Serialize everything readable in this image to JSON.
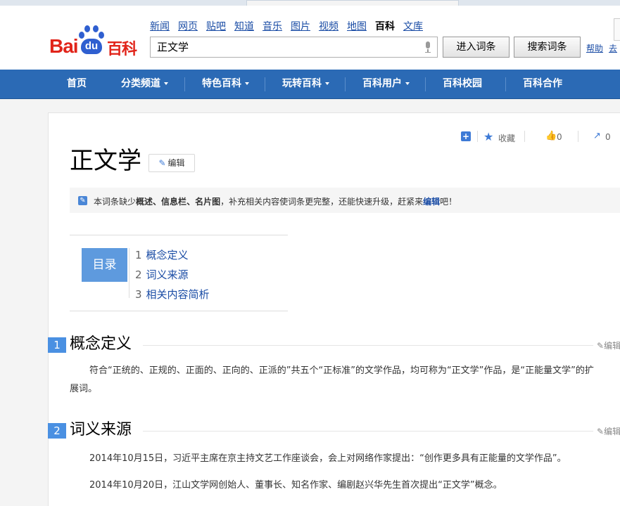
{
  "header": {
    "logo": {
      "bai": "Bai",
      "du": "du",
      "baike": "百科"
    },
    "nav_links": [
      {
        "label": "新闻",
        "active": false
      },
      {
        "label": "网页",
        "active": false
      },
      {
        "label": "贴吧",
        "active": false
      },
      {
        "label": "知道",
        "active": false
      },
      {
        "label": "音乐",
        "active": false
      },
      {
        "label": "图片",
        "active": false
      },
      {
        "label": "视频",
        "active": false
      },
      {
        "label": "地图",
        "active": false
      },
      {
        "label": "百科",
        "active": true
      },
      {
        "label": "文库",
        "active": false
      }
    ],
    "search": {
      "value": "正文学"
    },
    "enter_button": "进入词条",
    "search_button": "搜索词条",
    "help_link": "帮助",
    "help_link2": "去"
  },
  "main_nav": [
    {
      "label": "首页",
      "dropdown": false
    },
    {
      "label": "分类频道",
      "dropdown": true
    },
    {
      "label": "特色百科",
      "dropdown": true
    },
    {
      "label": "玩转百科",
      "dropdown": true
    },
    {
      "label": "百科用户",
      "dropdown": true
    },
    {
      "label": "百科校园",
      "dropdown": false
    },
    {
      "label": "百科合作",
      "dropdown": false
    }
  ],
  "toolbar": {
    "favorite_label": "收藏",
    "like_count": "0",
    "share_count": "0"
  },
  "article": {
    "title": "正文学",
    "edit_label": "编辑",
    "notice": {
      "prefix": "本词条缺少",
      "item1": "概述",
      "sep1": "、",
      "item2": "信息栏",
      "sep2": "、",
      "item3": "名片图",
      "middle": "，补充相关内容使词条更完整，还能快速升级，赶紧来",
      "link": "编辑",
      "suffix": "吧！"
    },
    "toc": {
      "label": "目录",
      "items": [
        {
          "num": "1",
          "text": "概念定义"
        },
        {
          "num": "2",
          "text": "词义来源"
        },
        {
          "num": "3",
          "text": "相关内容简析"
        }
      ]
    },
    "sections": [
      {
        "num": "1",
        "title": "概念定义",
        "edit": "编辑",
        "paragraphs": [
          "符合“正统的、正规的、正面的、正向的、正派的”共五个“正标准”的文学作品，均可称为“正文学”作品，是“正能量文学”的扩",
          "展词。"
        ]
      },
      {
        "num": "2",
        "title": "词义来源",
        "edit": "编辑",
        "paragraphs": [
          "2014年10月15日，习近平主席在京主持文艺工作座谈会，会上对网络作家提出：“创作更多具有正能量的文学作品”。",
          "2014年10月20日，江山文学网创始人、董事长、知名作家、编剧赵兴华先生首次提出“正文学”概念。"
        ]
      }
    ]
  },
  "colors": {
    "nav_blue": "#2b6ab5",
    "link_blue": "#1a4ca5",
    "logo_red": "#e1241a",
    "logo_blue": "#2f5fd0",
    "toc_blue": "#5e9ade"
  },
  "icons": [
    "mic-icon",
    "plus-icon",
    "star-icon",
    "thumb-up-icon",
    "share-icon",
    "pencil-icon",
    "notice-pencil-icon"
  ]
}
